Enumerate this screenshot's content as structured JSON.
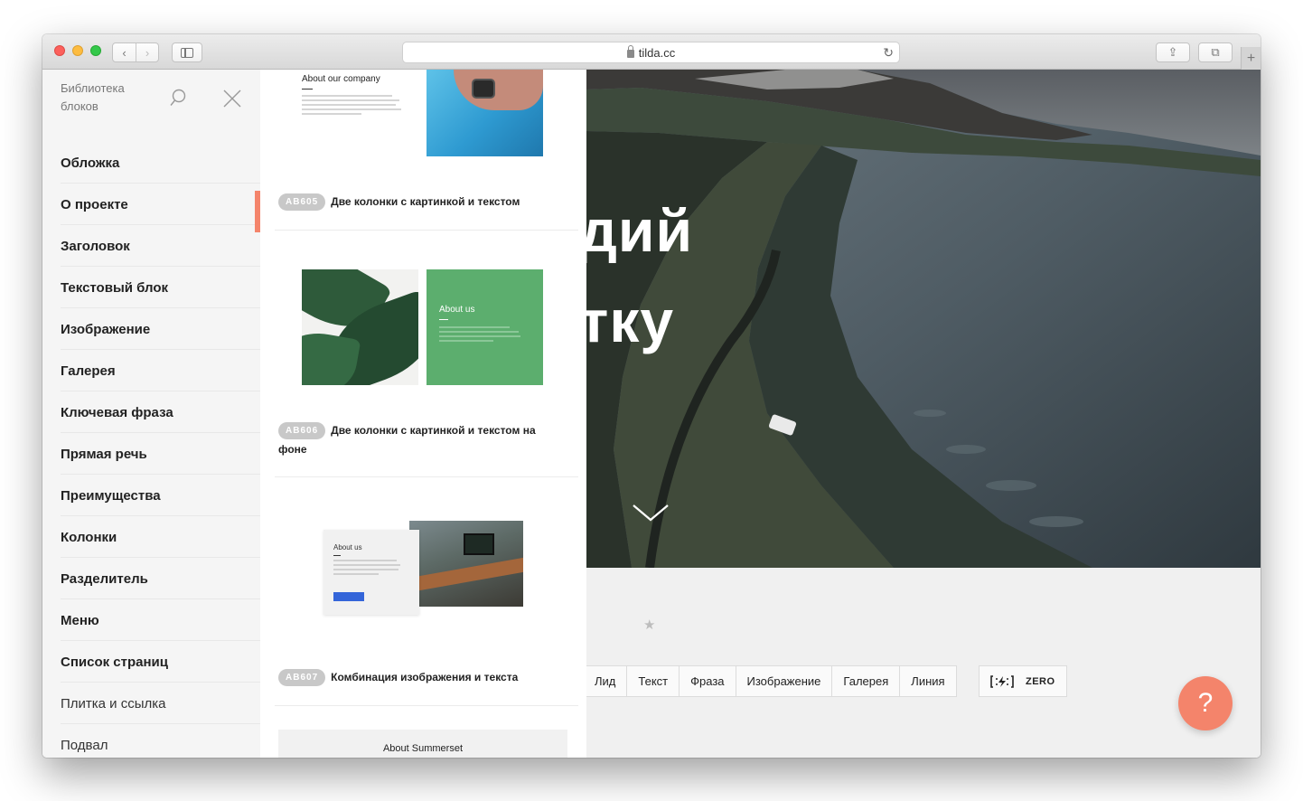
{
  "browser": {
    "url": "tilda.cc",
    "nav_back": "‹",
    "nav_forward": "›",
    "reload_glyph": "↻",
    "share_glyph": "⇪",
    "tabs_glyph": "⧉",
    "new_tab_glyph": "+"
  },
  "library": {
    "title": "Библиотека блоков",
    "categories": [
      {
        "label": "Обложка",
        "active": false
      },
      {
        "label": "О проекте",
        "active": true
      },
      {
        "label": "Заголовок",
        "active": false
      },
      {
        "label": "Текстовый блок",
        "active": false
      },
      {
        "label": "Изображение",
        "active": false
      },
      {
        "label": "Галерея",
        "active": false
      },
      {
        "label": "Ключевая фраза",
        "active": false
      },
      {
        "label": "Прямая речь",
        "active": false
      },
      {
        "label": "Преимущества",
        "active": false
      },
      {
        "label": "Колонки",
        "active": false
      },
      {
        "label": "Разделитель",
        "active": false
      },
      {
        "label": "Меню",
        "active": false
      },
      {
        "label": "Список страниц",
        "active": false
      },
      {
        "label": "Плитка и ссылка",
        "active": false
      },
      {
        "label": "Подвал",
        "active": false
      }
    ]
  },
  "blocks": [
    {
      "preview_title": "About our company",
      "code": "AB605",
      "name": "Две колонки с картинкой и текстом"
    },
    {
      "preview_title": "About us",
      "code": "AB606",
      "name": "Две колонки с картинкой и текстом на фоне"
    },
    {
      "preview_title": "About us",
      "code": "AB607",
      "name": "Комбинация изображения и текста"
    },
    {
      "preview_title": "About Summerset"
    }
  ],
  "hero": {
    "line1": "дий",
    "line2": "тку"
  },
  "toolbar": {
    "buttons": [
      "Лид",
      "Текст",
      "Фраза",
      "Изображение",
      "Галерея",
      "Линия"
    ],
    "zero_label": "ZERO",
    "help_label": "?"
  },
  "colors": {
    "accent": "#f4846b",
    "badge": "#c8c8c8",
    "green_block": "#5cae6e",
    "preview_button": "#3465d9"
  }
}
